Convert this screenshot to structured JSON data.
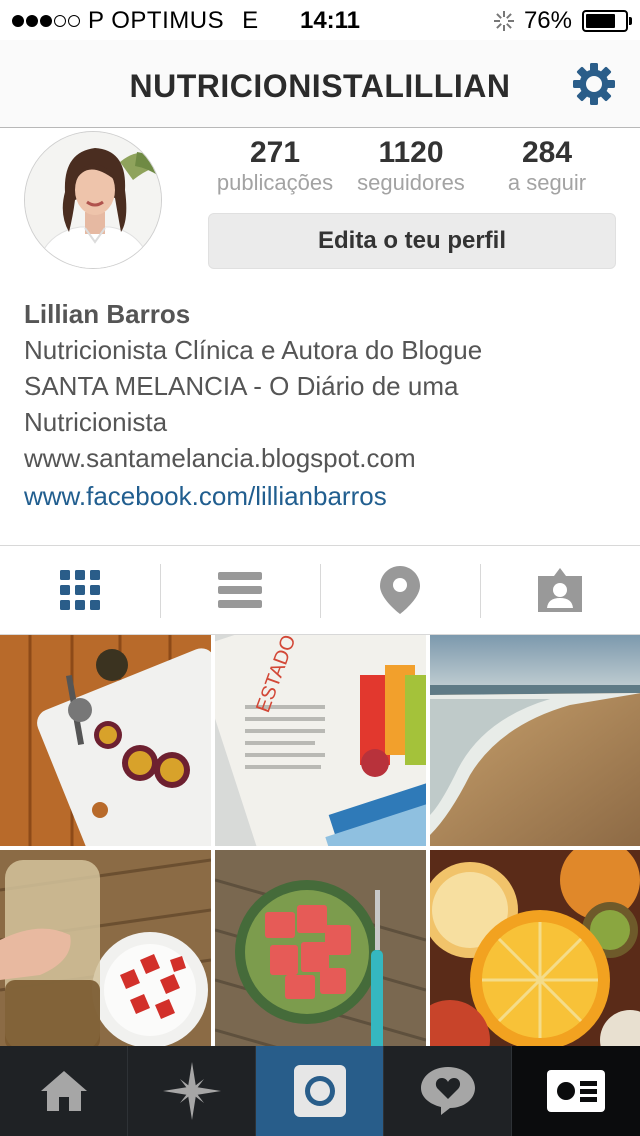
{
  "status_bar": {
    "signal_dots": 5,
    "signal_on": 3,
    "carrier": "P OPTIMUS",
    "network": "E",
    "time": "14:11",
    "battery_percent_text": "76%",
    "battery_level": 0.76
  },
  "nav": {
    "title": "NUTRICIONISTALILLIAN",
    "settings_icon": "gear-icon"
  },
  "profile": {
    "stats": [
      {
        "value": "271",
        "label": "publicações"
      },
      {
        "value": "1120",
        "label": "seguidores"
      },
      {
        "value": "284",
        "label": "a seguir"
      }
    ],
    "edit_button": "Edita o teu perfil",
    "name": "Lillian Barros",
    "bio_lines": [
      "Nutricionista Clínica e Autora do Blogue",
      "SANTA MELANCIA - O Diário de uma",
      "Nutricionista",
      "www.santamelancia.blogspot.com"
    ],
    "link": "www.facebook.com/lillianbarros"
  },
  "tabs": [
    {
      "icon": "grid-view-icon",
      "active": true
    },
    {
      "icon": "list-view-icon",
      "active": false
    },
    {
      "icon": "location-pin-icon",
      "active": false
    },
    {
      "icon": "tagged-photos-icon",
      "active": false
    }
  ],
  "photos": [
    "passion-fruit-photo",
    "magazine-juice-photo",
    "beach-photo",
    "jar-strawberries-photo",
    "watermelon-photo",
    "citrus-fruits-photo"
  ],
  "tabbar": [
    {
      "icon": "home-icon",
      "active": false
    },
    {
      "icon": "explore-star-icon",
      "active": false
    },
    {
      "icon": "camera-icon",
      "active": true
    },
    {
      "icon": "activity-heart-bubble-icon",
      "active": false
    },
    {
      "icon": "profile-card-icon",
      "active": false
    }
  ],
  "colors": {
    "accent": "#285d8a",
    "link": "#215e8f",
    "tab_icon_active": "#2a5d89",
    "tab_icon_inactive": "#999999",
    "tabbar_bg": "#1f2225"
  }
}
